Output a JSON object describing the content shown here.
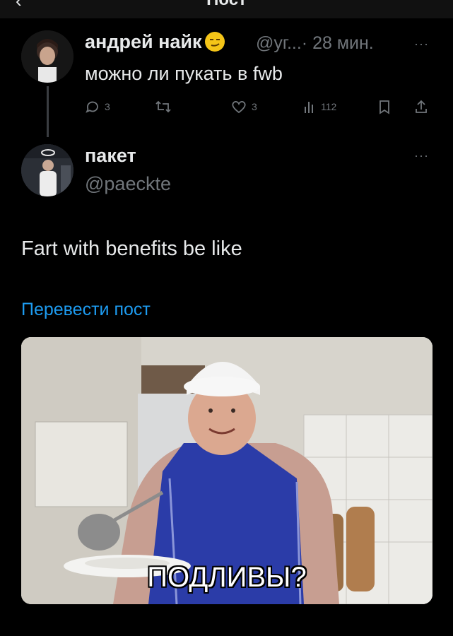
{
  "header": {
    "title": "Пост",
    "back_icon": "chevron-left-icon"
  },
  "reply": {
    "author_name": "андрей найк",
    "emoji": "smirk-emoji",
    "handle": "@уг...",
    "time": "· 28 мин.",
    "more": "···",
    "text": "можно ли пукать в fwb",
    "actions": {
      "replies": "3",
      "retweets": "",
      "likes": "3",
      "views": "112"
    }
  },
  "post": {
    "author_name": "пакет",
    "handle": "@paeckte",
    "more": "···",
    "text": "Fart with benefits be like",
    "translate_label": "Перевести пост",
    "media": {
      "caption": "ПОДЛИВЫ?"
    }
  },
  "colors": {
    "background": "#000000",
    "text": "#e7e9ea",
    "muted": "#71767b",
    "link": "#1d9bf0"
  }
}
